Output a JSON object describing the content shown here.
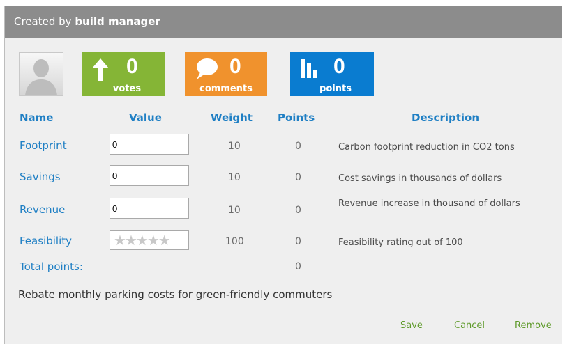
{
  "header": {
    "prefix": "Created by",
    "author": "build manager"
  },
  "stats": {
    "votes": {
      "value": "0",
      "label": "votes",
      "icon": "up-arrow-icon",
      "color": "#85b536"
    },
    "comments": {
      "value": "0",
      "label": "comments",
      "icon": "speech-bubble-icon",
      "color": "#f0922d"
    },
    "points": {
      "value": "0",
      "label": "points",
      "icon": "bar-chart-icon",
      "color": "#0a7cd0"
    }
  },
  "table": {
    "columns": [
      "Name",
      "Value",
      "Weight",
      "Points",
      "Description"
    ],
    "rows": [
      {
        "name": "Footprint",
        "value": "0",
        "weight": "10",
        "points": "0",
        "description": "Carbon footprint reduction in CO2 tons"
      },
      {
        "name": "Savings",
        "value": "0",
        "weight": "10",
        "points": "0",
        "description": "Cost savings in thousands of dollars"
      },
      {
        "name": "Revenue",
        "value": "0",
        "weight": "10",
        "points": "0",
        "description": "Revenue increase in thousand of dollars"
      },
      {
        "name": "Feasibility",
        "stars": 0,
        "weight": "100",
        "points": "0",
        "description": "Feasibility rating out of 100"
      }
    ],
    "total": {
      "label": "Total points:",
      "points": "0"
    }
  },
  "idea_text": "Rebate monthly parking costs for green-friendly commuters",
  "actions": {
    "save": "Save",
    "cancel": "Cancel",
    "remove": "Remove"
  }
}
